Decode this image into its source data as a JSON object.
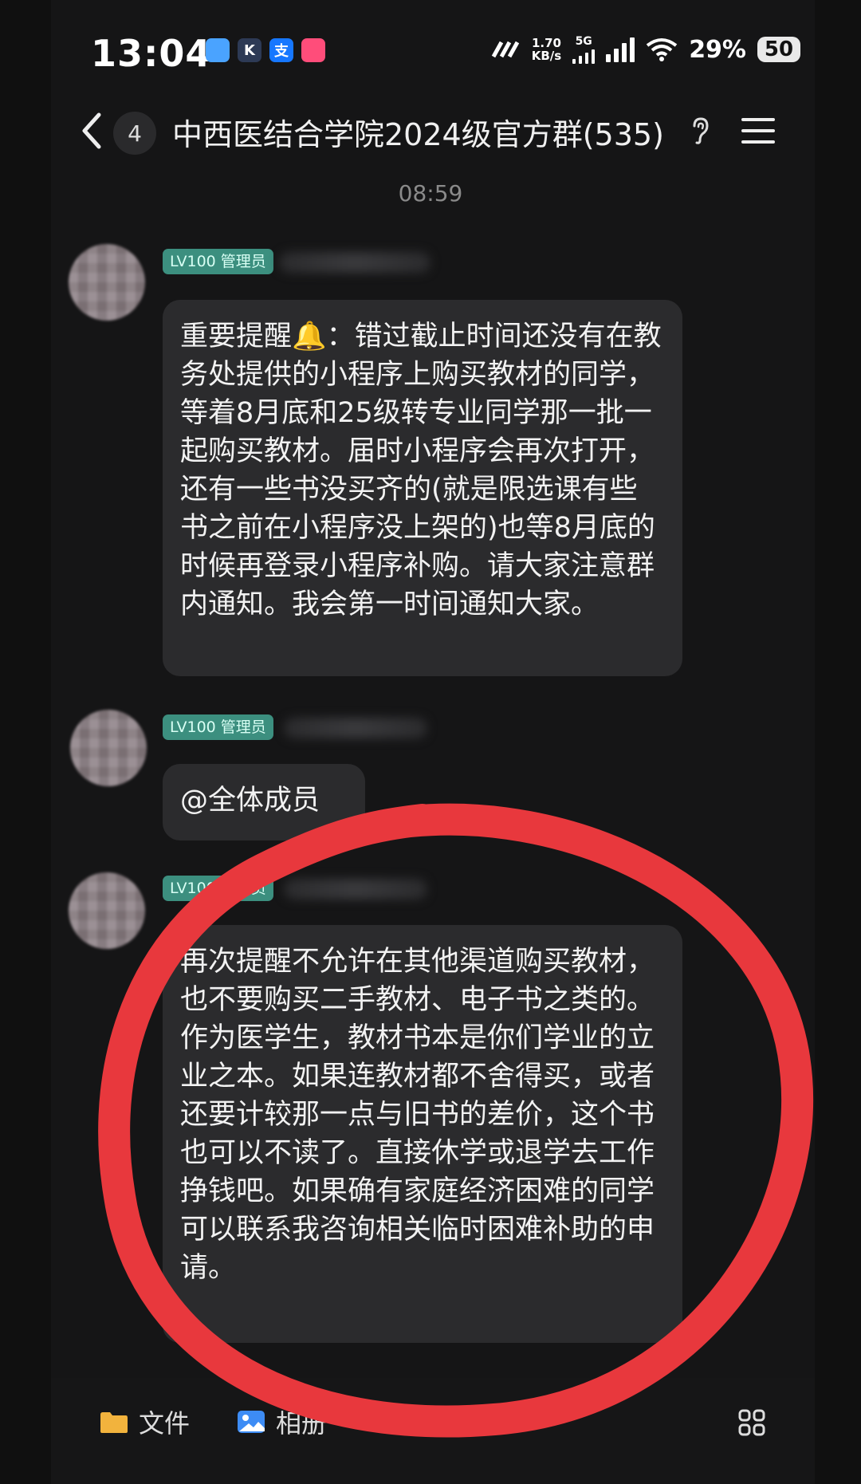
{
  "status_bar": {
    "time": "13:04",
    "net_speed_value": "1.70",
    "net_speed_unit": "KB/s",
    "network_type": "5G",
    "battery_percent": "29%",
    "battery_label": "50"
  },
  "header": {
    "unread_count": "4",
    "title": "中西医结合学院2024级官方群(535)"
  },
  "timestamp": "08:59",
  "messages": [
    {
      "badge": "LV100 管理员",
      "text": "重要提醒🔔：错过截止时间还没有在教务处提供的小程序上购买教材的同学，等着8月底和25级转专业同学那一批一起购买教材。届时小程序会再次打开，还有一些书没买齐的(就是限选课有些书之前在小程序没上架的)也等8月底的时候再登录小程序补购。请大家注意群内通知。我会第一时间通知大家。"
    },
    {
      "badge": "LV100 管理员",
      "text": "@全体成员"
    },
    {
      "badge": "LV100 管理员",
      "text": "再次提醒不允许在其他渠道购买教材，也不要购买二手教材、电子书之类的。作为医学生，教材书本是你们学业的立业之本。如果连教材都不舍得买，或者还要计较那一点与旧书的差价，这个书也可以不读了。直接休学或退学去工作挣钱吧。如果确有家庭经济困难的同学可以联系我咨询相关临时困难补助的申请。"
    }
  ],
  "toolbar": {
    "file_label": "文件",
    "album_label": "相册"
  },
  "colors": {
    "admin_badge": "#3c8f7f",
    "bubble": "#2b2b2d",
    "annotation_circle": "#e8383d"
  }
}
